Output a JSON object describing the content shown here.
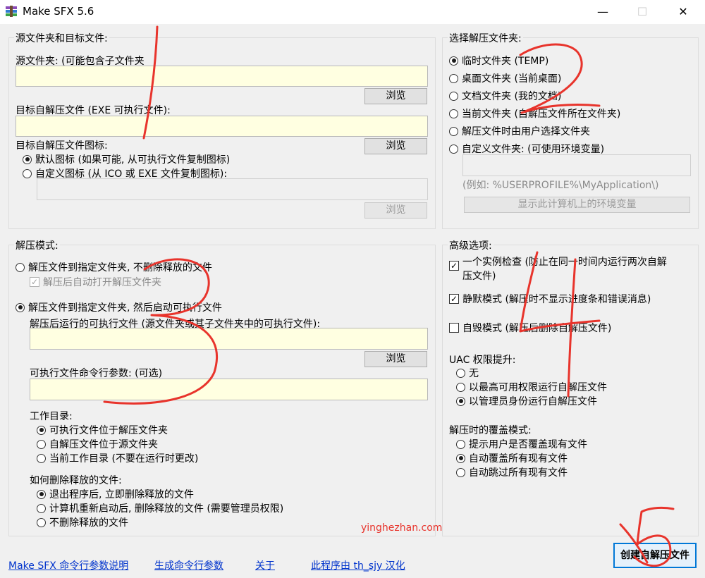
{
  "window": {
    "title": "Make SFX 5.6",
    "minimize": "—",
    "maximize": "☐",
    "close": "✕"
  },
  "source_group": {
    "title": "源文件夹和目标文件:",
    "source_label": "源文件夹: (可能包含子文件夹",
    "browse1": "浏览",
    "target_label": "目标自解压文件 (EXE 可执行文件):",
    "browse2": "浏览",
    "icon_label": "目标自解压文件图标:",
    "icon_default": "默认图标 (如果可能, 从可执行文件复制图标)",
    "icon_custom": "自定义图标 (从 ICO 或 EXE 文件复制图标):",
    "browse3": "浏览"
  },
  "extract_dir_group": {
    "title": "选择解压文件夹:",
    "options": [
      "临时文件夹 (TEMP)",
      "桌面文件夹 (当前桌面)",
      "文档文件夹 (我的文档)",
      "当前文件夹 (自解压文件所在文件夹)",
      "解压文件时由用户选择文件夹",
      "自定义文件夹: (可使用环境变量)"
    ],
    "example": "(例如: %USERPROFILE%\\MyApplication\\)",
    "env_button": "显示此计算机上的环境变量"
  },
  "mode_group": {
    "title": "解压模式:",
    "mode1": "解压文件到指定文件夹, 不删除释放的文件",
    "auto_open": "解压后自动打开解压文件夹",
    "mode2": "解压文件到指定文件夹, 然后启动可执行文件",
    "exe_label": "解压后运行的可执行文件 (源文件夹或其子文件夹中的可执行文件):",
    "browse4": "浏览",
    "args_label": "可执行文件命令行参数: (可选)",
    "workdir_label": "工作目录:",
    "workdir_options": [
      "可执行文件位于解压文件夹",
      "自解压文件位于源文件夹",
      "当前工作目录 (不要在运行时更改)"
    ],
    "delete_label": "如何删除释放的文件:",
    "delete_options": [
      "退出程序后, 立即删除释放的文件",
      "计算机重新启动后, 删除释放的文件 (需要管理员权限)",
      "不删除释放的文件"
    ]
  },
  "advanced_group": {
    "title": "高级选项:",
    "single_line1": "一个实例检查 (防止在同一时间内运行两次自解",
    "single_line2": "压文件)",
    "silent": "静默模式 (解压时不显示进度条和错误消息)",
    "selfdelete": "自毁模式 (解压后删除自解压文件)",
    "uac_label": "UAC 权限提升:",
    "uac_options": [
      "无",
      "以最高可用权限运行自解压文件",
      "以管理员身份运行自解压文件"
    ],
    "overwrite_label": "解压时的覆盖模式:",
    "overwrite_options": [
      "提示用户是否覆盖现有文件",
      "自动覆盖所有现有文件",
      "自动跳过所有现有文件"
    ]
  },
  "footer": {
    "link1": "Make SFX 命令行参数说明",
    "link2": "生成命令行参数",
    "link3": "关于",
    "link4": "此程序由 th_sjy 汉化",
    "create": "创建自解压文件"
  },
  "watermark": "yinghezhan.com",
  "accent": "#0078d7"
}
